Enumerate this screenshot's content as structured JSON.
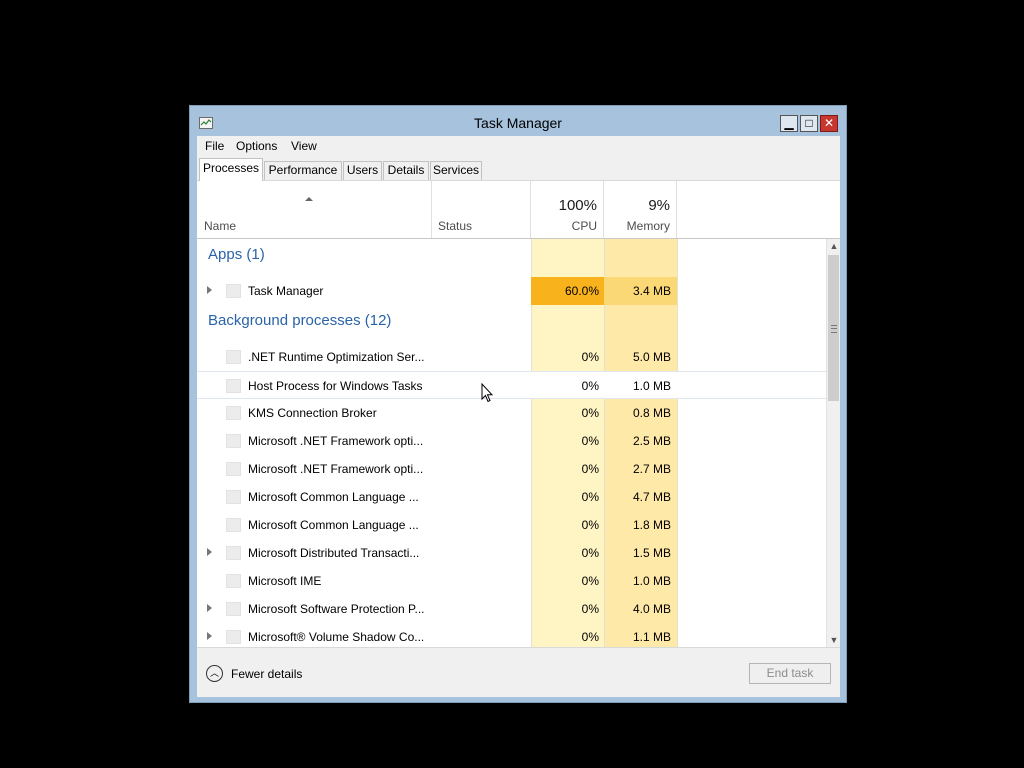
{
  "window": {
    "title": "Task Manager",
    "minimize_glyph": "▁",
    "maximize_glyph": "□",
    "close_glyph": "✕"
  },
  "menu": [
    "File",
    "Options",
    "View"
  ],
  "tabs": [
    {
      "label": "Processes",
      "active": true
    },
    {
      "label": "Performance",
      "active": false
    },
    {
      "label": "Users",
      "active": false
    },
    {
      "label": "Details",
      "active": false
    },
    {
      "label": "Services",
      "active": false
    }
  ],
  "columns": {
    "name": "Name",
    "status": "Status",
    "cpu_pct": "100%",
    "cpu": "CPU",
    "mem_pct": "9%",
    "memory": "Memory"
  },
  "groups": {
    "apps": "Apps (1)",
    "background": "Background processes (12)"
  },
  "apps": [
    {
      "name": "Task Manager",
      "cpu": "60.0%",
      "memory": "3.4 MB",
      "expandable": true
    }
  ],
  "background": [
    {
      "name": ".NET Runtime Optimization Ser...",
      "cpu": "0%",
      "memory": "5.0 MB",
      "expandable": false
    },
    {
      "name": "Host Process for Windows Tasks",
      "cpu": "0%",
      "memory": "1.0 MB",
      "expandable": false
    },
    {
      "name": "KMS Connection Broker",
      "cpu": "0%",
      "memory": "0.8 MB",
      "expandable": false
    },
    {
      "name": "Microsoft .NET Framework opti...",
      "cpu": "0%",
      "memory": "2.5 MB",
      "expandable": false
    },
    {
      "name": "Microsoft .NET Framework opti...",
      "cpu": "0%",
      "memory": "2.7 MB",
      "expandable": false
    },
    {
      "name": "Microsoft Common Language ...",
      "cpu": "0%",
      "memory": "4.7 MB",
      "expandable": false
    },
    {
      "name": "Microsoft Common Language ...",
      "cpu": "0%",
      "memory": "1.8 MB",
      "expandable": false
    },
    {
      "name": "Microsoft Distributed Transacti...",
      "cpu": "0%",
      "memory": "1.5 MB",
      "expandable": true
    },
    {
      "name": "Microsoft IME",
      "cpu": "0%",
      "memory": "1.0 MB",
      "expandable": false
    },
    {
      "name": "Microsoft Software Protection P...",
      "cpu": "0%",
      "memory": "4.0 MB",
      "expandable": true
    },
    {
      "name": "Microsoft® Volume Shadow Co...",
      "cpu": "0%",
      "memory": "1.1 MB",
      "expandable": true
    }
  ],
  "footer": {
    "fewer_details": "Fewer details",
    "end_task": "End task"
  },
  "colors": {
    "group_header": "#2a63a8",
    "cpu_hot": "#f8b21c",
    "cpu_light": "#fff4c4",
    "mem_light": "#ffe9a8",
    "title_bar": "#a6c2dc",
    "close_button": "#c7372f"
  },
  "icons": {
    "app_icon": "task-manager-app-icon",
    "fewer_details": "chevron-up-circle-icon"
  }
}
